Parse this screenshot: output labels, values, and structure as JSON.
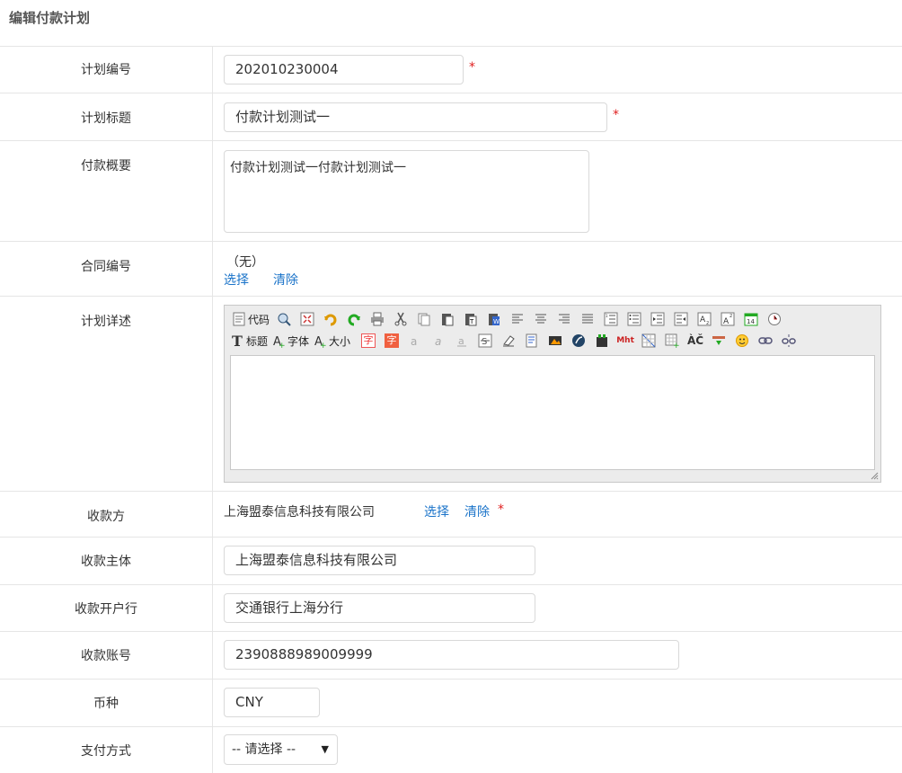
{
  "header": {
    "title": "编辑付款计划"
  },
  "fields": {
    "plan_no": {
      "label": "计划编号",
      "value": "202010230004"
    },
    "plan_title": {
      "label": "计划标题",
      "value": "付款计划测试一"
    },
    "summary": {
      "label": "付款概要",
      "value": "付款计划测试一付款计划测试一"
    },
    "contract_no": {
      "label": "合同编号",
      "value": "（无）",
      "select": "选择",
      "clear": "清除"
    },
    "detail": {
      "label": "计划详述"
    },
    "payee": {
      "label": "收款方",
      "value": "上海盟泰信息科技有限公司",
      "select": "选择",
      "clear": "清除"
    },
    "payee_entity": {
      "label": "收款主体",
      "value": "上海盟泰信息科技有限公司"
    },
    "payee_bank": {
      "label": "收款开户行",
      "value": "交通银行上海分行"
    },
    "payee_account": {
      "label": "收款账号",
      "value": "2390888989009999"
    },
    "currency": {
      "label": "币种",
      "value": "CNY"
    },
    "pay_method": {
      "label": "支付方式",
      "value": "-- 请选择 --"
    }
  },
  "required_mark": "*",
  "toolbar": {
    "code_label": "代码",
    "title_label": "标题",
    "font_label": "字体",
    "size_label": "大小",
    "zi": "字",
    "mht": "Mht",
    "ac": "ÀČ",
    "cal": "14",
    "row1_icons": [
      "source-code-icon",
      "zoom-icon",
      "fullscreen-icon",
      "undo-icon",
      "redo-icon",
      "print-icon",
      "cut-icon",
      "copy-icon",
      "paste-icon",
      "paste-text-icon",
      "paste-word-icon",
      "align-left-icon",
      "align-center-icon",
      "align-right-icon",
      "align-justify-icon",
      "ordered-list-icon",
      "unordered-list-icon",
      "indent-icon",
      "outdent-icon",
      "subscript-icon",
      "superscript-icon",
      "date-icon",
      "time-icon"
    ],
    "row2_icons": [
      "heading-icon",
      "font-family-icon",
      "font-size-icon",
      "text-color-icon",
      "bg-color-icon",
      "bold-icon",
      "italic-icon",
      "underline-icon",
      "strikethrough-icon",
      "clear-format-icon",
      "select-all-icon",
      "image-icon",
      "flash-icon",
      "media-icon",
      "mht-icon",
      "table-icon",
      "table-insert-icon",
      "special-char-icon",
      "hr-icon",
      "emoticon-icon",
      "link-icon",
      "unlink-icon"
    ]
  }
}
